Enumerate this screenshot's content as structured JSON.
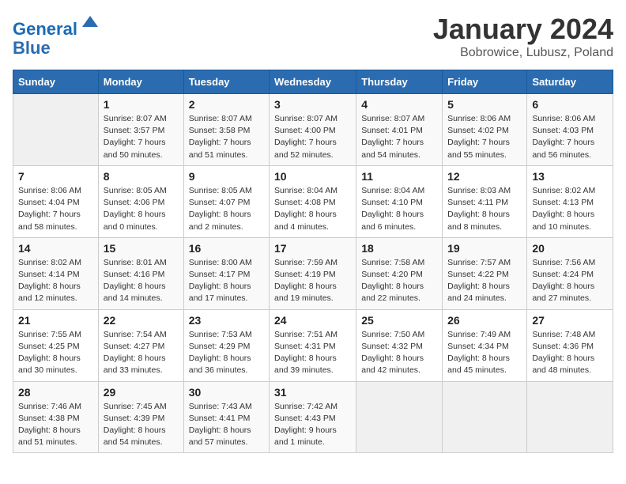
{
  "header": {
    "logo_line1": "General",
    "logo_line2": "Blue",
    "month_title": "January 2024",
    "subtitle": "Bobrowice, Lubusz, Poland"
  },
  "days_of_week": [
    "Sunday",
    "Monday",
    "Tuesday",
    "Wednesday",
    "Thursday",
    "Friday",
    "Saturday"
  ],
  "weeks": [
    [
      {
        "num": "",
        "info": ""
      },
      {
        "num": "1",
        "info": "Sunrise: 8:07 AM\nSunset: 3:57 PM\nDaylight: 7 hours\nand 50 minutes."
      },
      {
        "num": "2",
        "info": "Sunrise: 8:07 AM\nSunset: 3:58 PM\nDaylight: 7 hours\nand 51 minutes."
      },
      {
        "num": "3",
        "info": "Sunrise: 8:07 AM\nSunset: 4:00 PM\nDaylight: 7 hours\nand 52 minutes."
      },
      {
        "num": "4",
        "info": "Sunrise: 8:07 AM\nSunset: 4:01 PM\nDaylight: 7 hours\nand 54 minutes."
      },
      {
        "num": "5",
        "info": "Sunrise: 8:06 AM\nSunset: 4:02 PM\nDaylight: 7 hours\nand 55 minutes."
      },
      {
        "num": "6",
        "info": "Sunrise: 8:06 AM\nSunset: 4:03 PM\nDaylight: 7 hours\nand 56 minutes."
      }
    ],
    [
      {
        "num": "7",
        "info": "Sunrise: 8:06 AM\nSunset: 4:04 PM\nDaylight: 7 hours\nand 58 minutes."
      },
      {
        "num": "8",
        "info": "Sunrise: 8:05 AM\nSunset: 4:06 PM\nDaylight: 8 hours\nand 0 minutes."
      },
      {
        "num": "9",
        "info": "Sunrise: 8:05 AM\nSunset: 4:07 PM\nDaylight: 8 hours\nand 2 minutes."
      },
      {
        "num": "10",
        "info": "Sunrise: 8:04 AM\nSunset: 4:08 PM\nDaylight: 8 hours\nand 4 minutes."
      },
      {
        "num": "11",
        "info": "Sunrise: 8:04 AM\nSunset: 4:10 PM\nDaylight: 8 hours\nand 6 minutes."
      },
      {
        "num": "12",
        "info": "Sunrise: 8:03 AM\nSunset: 4:11 PM\nDaylight: 8 hours\nand 8 minutes."
      },
      {
        "num": "13",
        "info": "Sunrise: 8:02 AM\nSunset: 4:13 PM\nDaylight: 8 hours\nand 10 minutes."
      }
    ],
    [
      {
        "num": "14",
        "info": "Sunrise: 8:02 AM\nSunset: 4:14 PM\nDaylight: 8 hours\nand 12 minutes."
      },
      {
        "num": "15",
        "info": "Sunrise: 8:01 AM\nSunset: 4:16 PM\nDaylight: 8 hours\nand 14 minutes."
      },
      {
        "num": "16",
        "info": "Sunrise: 8:00 AM\nSunset: 4:17 PM\nDaylight: 8 hours\nand 17 minutes."
      },
      {
        "num": "17",
        "info": "Sunrise: 7:59 AM\nSunset: 4:19 PM\nDaylight: 8 hours\nand 19 minutes."
      },
      {
        "num": "18",
        "info": "Sunrise: 7:58 AM\nSunset: 4:20 PM\nDaylight: 8 hours\nand 22 minutes."
      },
      {
        "num": "19",
        "info": "Sunrise: 7:57 AM\nSunset: 4:22 PM\nDaylight: 8 hours\nand 24 minutes."
      },
      {
        "num": "20",
        "info": "Sunrise: 7:56 AM\nSunset: 4:24 PM\nDaylight: 8 hours\nand 27 minutes."
      }
    ],
    [
      {
        "num": "21",
        "info": "Sunrise: 7:55 AM\nSunset: 4:25 PM\nDaylight: 8 hours\nand 30 minutes."
      },
      {
        "num": "22",
        "info": "Sunrise: 7:54 AM\nSunset: 4:27 PM\nDaylight: 8 hours\nand 33 minutes."
      },
      {
        "num": "23",
        "info": "Sunrise: 7:53 AM\nSunset: 4:29 PM\nDaylight: 8 hours\nand 36 minutes."
      },
      {
        "num": "24",
        "info": "Sunrise: 7:51 AM\nSunset: 4:31 PM\nDaylight: 8 hours\nand 39 minutes."
      },
      {
        "num": "25",
        "info": "Sunrise: 7:50 AM\nSunset: 4:32 PM\nDaylight: 8 hours\nand 42 minutes."
      },
      {
        "num": "26",
        "info": "Sunrise: 7:49 AM\nSunset: 4:34 PM\nDaylight: 8 hours\nand 45 minutes."
      },
      {
        "num": "27",
        "info": "Sunrise: 7:48 AM\nSunset: 4:36 PM\nDaylight: 8 hours\nand 48 minutes."
      }
    ],
    [
      {
        "num": "28",
        "info": "Sunrise: 7:46 AM\nSunset: 4:38 PM\nDaylight: 8 hours\nand 51 minutes."
      },
      {
        "num": "29",
        "info": "Sunrise: 7:45 AM\nSunset: 4:39 PM\nDaylight: 8 hours\nand 54 minutes."
      },
      {
        "num": "30",
        "info": "Sunrise: 7:43 AM\nSunset: 4:41 PM\nDaylight: 8 hours\nand 57 minutes."
      },
      {
        "num": "31",
        "info": "Sunrise: 7:42 AM\nSunset: 4:43 PM\nDaylight: 9 hours\nand 1 minute."
      },
      {
        "num": "",
        "info": ""
      },
      {
        "num": "",
        "info": ""
      },
      {
        "num": "",
        "info": ""
      }
    ]
  ]
}
